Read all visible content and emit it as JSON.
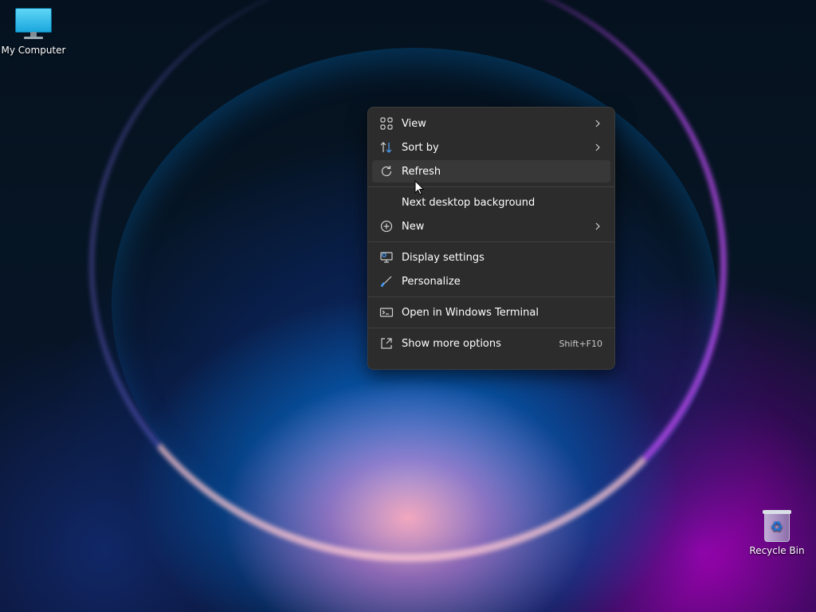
{
  "desktop": {
    "icons": {
      "my_computer": {
        "label": "My Computer",
        "icon": "monitor-icon"
      },
      "recycle_bin": {
        "label": "Recycle Bin",
        "icon": "recycle-bin-icon"
      }
    }
  },
  "context_menu": {
    "items": {
      "view": {
        "label": "View",
        "icon": "grid-icon",
        "has_submenu": true
      },
      "sort_by": {
        "label": "Sort by",
        "icon": "sort-icon",
        "has_submenu": true
      },
      "refresh": {
        "label": "Refresh",
        "icon": "refresh-icon",
        "hovered": true
      },
      "next_background": {
        "label": "Next desktop background"
      },
      "new": {
        "label": "New",
        "icon": "plus-circle-icon",
        "has_submenu": true
      },
      "display_settings": {
        "label": "Display settings",
        "icon": "display-settings-icon"
      },
      "personalize": {
        "label": "Personalize",
        "icon": "brush-icon"
      },
      "open_terminal": {
        "label": "Open in Windows Terminal",
        "icon": "terminal-icon"
      },
      "show_more": {
        "label": "Show more options",
        "icon": "share-icon",
        "shortcut": "Shift+F10"
      }
    }
  },
  "theme": {
    "menu_background": "#2c2c2c",
    "menu_hover": "#383838",
    "accent": "#0078d4"
  }
}
